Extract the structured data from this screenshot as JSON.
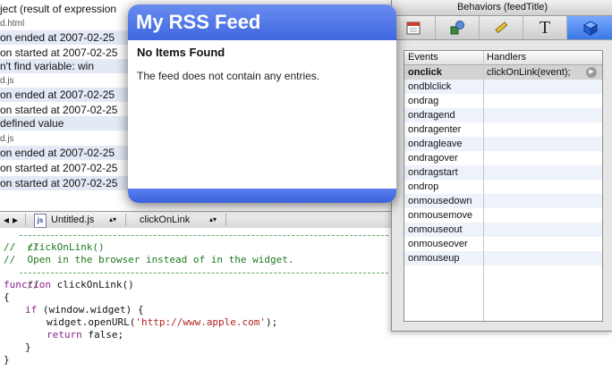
{
  "console": {
    "lines": [
      {
        "text": "ject  (result of expression",
        "type": "text",
        "shade": false
      },
      {
        "text": "d.html",
        "type": "file",
        "shade": false
      },
      {
        "text": "on ended at 2007-02-25",
        "type": "text",
        "shade": true
      },
      {
        "text": "on started at 2007-02-25",
        "type": "text",
        "shade": false
      },
      {
        "text": "n't find variable: win",
        "type": "text",
        "shade": true
      },
      {
        "text": "d.js",
        "type": "file",
        "shade": false
      },
      {
        "text": "on ended at 2007-02-25",
        "type": "text",
        "shade": true
      },
      {
        "text": "on started at 2007-02-25",
        "type": "text",
        "shade": false
      },
      {
        "text": "defined value",
        "type": "text",
        "shade": true
      },
      {
        "text": "d.js",
        "type": "file",
        "shade": false
      },
      {
        "text": "on ended at 2007-02-25",
        "type": "text",
        "shade": true
      },
      {
        "text": "on started at 2007-02-25",
        "type": "text",
        "shade": false
      },
      {
        "text": "on started at 2007-02-25",
        "type": "text",
        "shade": true
      }
    ]
  },
  "editor": {
    "file_name": "Untitled.js",
    "file_icon_text": "js",
    "function_menu": "clickOnLink",
    "code": {
      "comment_open": "//",
      "comment_line1": "//  clickOnLink()",
      "comment_line2": "//  Open in the browser instead of in the widget.",
      "comment_close": "//",
      "fn_keyword": "function",
      "fn_name": " clickOnLink()",
      "brace_open": "{",
      "if_keyword": "if",
      "if_cond": " (window.widget) {",
      "call_prefix": "widget.openURL(",
      "call_string": "'http://www.apple.com'",
      "call_suffix": ");",
      "return_keyword": "return",
      "return_value": " false;",
      "inner_close": "}",
      "brace_close": "}"
    }
  },
  "widget": {
    "title": "My RSS Feed",
    "no_items": "No Items Found",
    "message": "The feed does not contain any entries.",
    "header_color": "#4a72e6"
  },
  "behaviors": {
    "title": "Behaviors (feedTitle)",
    "tabs": [
      {
        "icon": "calendar-icon",
        "glyph": "▦"
      },
      {
        "icon": "arrange-icon",
        "glyph": "◈"
      },
      {
        "icon": "ruler-icon",
        "glyph": "✎"
      },
      {
        "icon": "text-icon",
        "glyph": "T"
      },
      {
        "icon": "cube-icon",
        "glyph": "◆"
      }
    ],
    "columns": {
      "events": "Events",
      "handlers": "Handlers"
    },
    "rows": [
      {
        "event": "onclick",
        "handler": "clickOnLink(event);"
      },
      {
        "event": "ondblclick",
        "handler": ""
      },
      {
        "event": "ondrag",
        "handler": ""
      },
      {
        "event": "ondragend",
        "handler": ""
      },
      {
        "event": "ondragenter",
        "handler": ""
      },
      {
        "event": "ondragleave",
        "handler": ""
      },
      {
        "event": "ondragover",
        "handler": ""
      },
      {
        "event": "ondragstart",
        "handler": ""
      },
      {
        "event": "ondrop",
        "handler": ""
      },
      {
        "event": "onmousedown",
        "handler": ""
      },
      {
        "event": "onmousemove",
        "handler": ""
      },
      {
        "event": "onmouseout",
        "handler": ""
      },
      {
        "event": "onmouseover",
        "handler": ""
      },
      {
        "event": "onmouseup",
        "handler": ""
      }
    ]
  }
}
